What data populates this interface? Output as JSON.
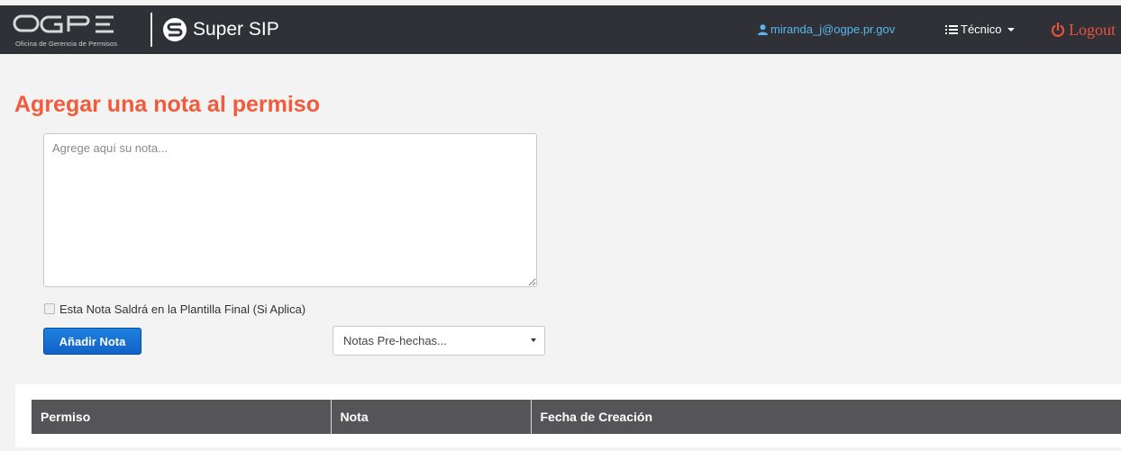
{
  "navbar": {
    "logo_subtitle": "Oficina de Gerencia de Permisos",
    "logo_icon": "ogpe-logo",
    "brand_icon": "super-sip-s-icon",
    "brand": "Super SIP",
    "user_email": "miranda_j@ogpe.pr.gov",
    "user_icon": "user-icon",
    "menu_label": "Técnico",
    "menu_icon": "list-icon",
    "logout_label": "Logout",
    "logout_icon": "power-icon",
    "colors": {
      "bar": "#2f3136",
      "user_link": "#58b7ee",
      "logout": "#e8523e"
    }
  },
  "page": {
    "title": "Agregar una nota al permiso",
    "title_color": "#f15a3b"
  },
  "note_form": {
    "note_placeholder": "Agrege aquí su nota...",
    "note_value": "",
    "checkbox_label": "Esta Nota Saldrá en la Plantilla Final (Si Aplica)",
    "checkbox_checked": false,
    "add_button": "Añadir Nota",
    "preset_select": "Notas Pre-hechas...",
    "button_color": "#1262c6"
  },
  "notes_table": {
    "headers": [
      "Permiso",
      "Nota",
      "Fecha de Creación"
    ],
    "rows": [],
    "header_color": "#555558"
  }
}
